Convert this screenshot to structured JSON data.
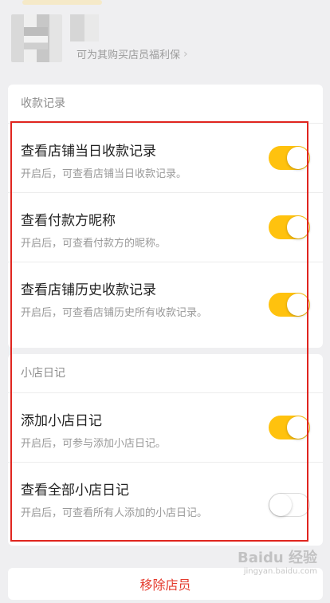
{
  "header": {
    "subtitle": "可为其购买店员福利保",
    "chevron": "›"
  },
  "sections": [
    {
      "title": "收款记录",
      "items": [
        {
          "title": "查看店铺当日收款记录",
          "desc": "开启后，可查看店铺当日收款记录。",
          "on": true
        },
        {
          "title": "查看付款方昵称",
          "desc": "开启后，可查看付款方的昵称。",
          "on": true
        },
        {
          "title": "查看店铺历史收款记录",
          "desc": "开启后，可查看店铺历史所有收款记录。",
          "on": true
        }
      ]
    },
    {
      "title": "小店日记",
      "items": [
        {
          "title": "添加小店日记",
          "desc": "开启后，可参与添加小店日记。",
          "on": true
        },
        {
          "title": "查看全部小店日记",
          "desc": "开启后，可查看所有人添加的小店日记。",
          "on": false
        }
      ]
    }
  ],
  "bottom": {
    "label": "移除店员"
  },
  "watermark": {
    "main": "Baidu 经验",
    "sub": "jingyan.baidu.com"
  },
  "colors": {
    "toggle_on": "#ffc20e",
    "highlight": "#e0251f",
    "danger": "#e43c2f"
  }
}
